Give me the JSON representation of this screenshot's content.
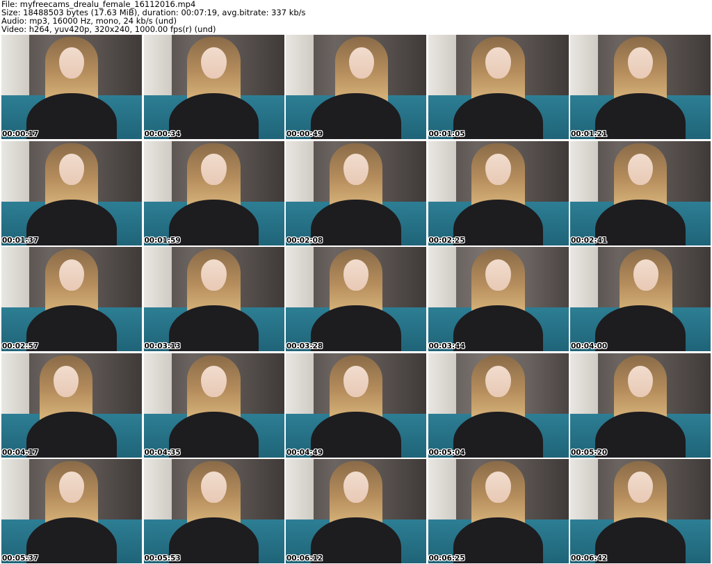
{
  "header": {
    "file_line": "File: myfreecams_drealu_female_16112016.mp4",
    "size_line": "Size: 18488503 bytes (17.63 MiB), duration: 00:07:19, avg.bitrate: 337 kb/s",
    "audio_line": "Audio: mp3, 16000 Hz, mono, 24 kb/s (und)",
    "video_line": "Video: h264, yuv420p, 320x240, 1000.00 fps(r) (und)"
  },
  "frames": [
    {
      "timestamp": "00:00:17"
    },
    {
      "timestamp": "00:00:34"
    },
    {
      "timestamp": "00:00:49"
    },
    {
      "timestamp": "00:01:05"
    },
    {
      "timestamp": "00:01:21"
    },
    {
      "timestamp": "00:01:37"
    },
    {
      "timestamp": "00:01:59"
    },
    {
      "timestamp": "00:02:08"
    },
    {
      "timestamp": "00:02:25"
    },
    {
      "timestamp": "00:02:41"
    },
    {
      "timestamp": "00:02:57"
    },
    {
      "timestamp": "00:03:13"
    },
    {
      "timestamp": "00:03:28"
    },
    {
      "timestamp": "00:03:44"
    },
    {
      "timestamp": "00:04:00"
    },
    {
      "timestamp": "00:04:17"
    },
    {
      "timestamp": "00:04:35"
    },
    {
      "timestamp": "00:04:49"
    },
    {
      "timestamp": "00:05:04"
    },
    {
      "timestamp": "00:05:20"
    },
    {
      "timestamp": "00:05:37"
    },
    {
      "timestamp": "00:05:53"
    },
    {
      "timestamp": "00:06:12"
    },
    {
      "timestamp": "00:06:25"
    },
    {
      "timestamp": "00:06:42"
    }
  ]
}
